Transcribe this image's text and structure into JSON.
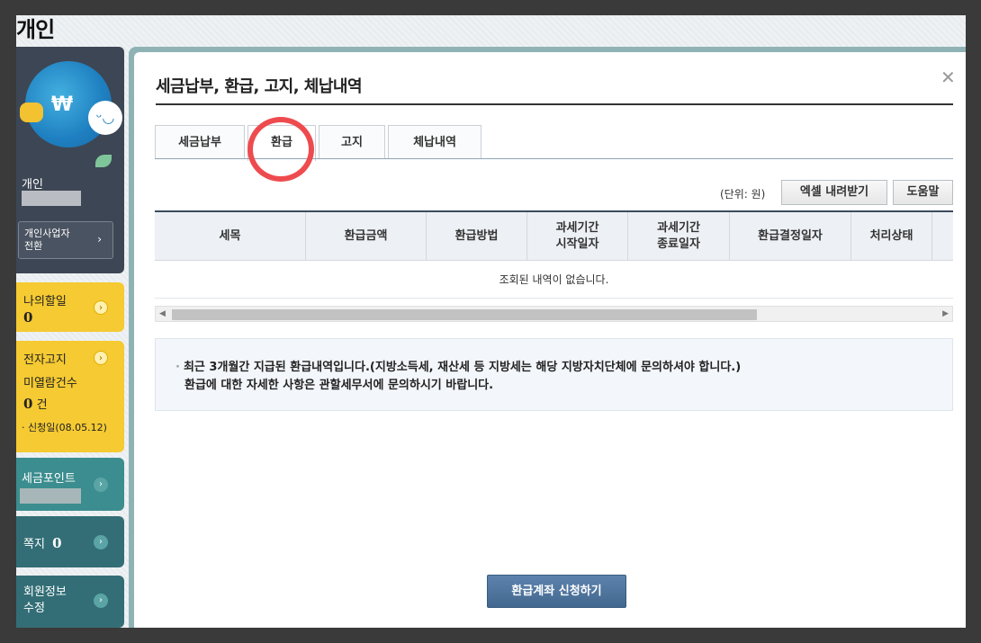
{
  "page_title": "개인",
  "sidebar": {
    "profile_label": "개인",
    "switch_button": [
      "개인사업자",
      "전환"
    ],
    "todo": {
      "label": "나의할일",
      "count": "0"
    },
    "notice": {
      "label": "전자고지",
      "sub": "미열람건수",
      "count": "0",
      "unit": "건",
      "date": "· 신청일(08.05.12)"
    },
    "points": {
      "label": "세금포인트"
    },
    "messages": {
      "label": "쪽지",
      "count": "0"
    },
    "member": {
      "label": [
        "회원정보",
        "수정"
      ]
    }
  },
  "dialog": {
    "title": "세금납부, 환급, 고지, 체납내역",
    "tabs": [
      "세금납부",
      "환급",
      "고지",
      "체납내역"
    ],
    "active_tab": "환급",
    "unit_label": "(단위: 원)",
    "excel_button": "엑셀 내려받기",
    "help_button": "도움말",
    "columns": [
      [
        "세목"
      ],
      [
        "환급금액"
      ],
      [
        "환급방법"
      ],
      [
        "과세기간",
        "시작일자"
      ],
      [
        "과세기간",
        "종료일자"
      ],
      [
        "환급결정일자"
      ],
      [
        "처리상태"
      ]
    ],
    "empty_message": "조회된 내역이 없습니다.",
    "info_lines": [
      "최근 3개월간 지급된 환급내역입니다.(지방소득세, 재산세 등 지방세는 해당 지방자치단체에 문의하셔야 합니다.)",
      "환급에 대한 자세한 사항은 관할세무서에 문의하시기 바랍니다."
    ],
    "apply_button": "환급계좌 신청하기"
  },
  "colors": {
    "highlight_ring": "#ee4b4e",
    "primary_button": "#4a6f96",
    "sidebar_yellow": "#f5ca32",
    "sidebar_teal": "#3c8d8f"
  }
}
